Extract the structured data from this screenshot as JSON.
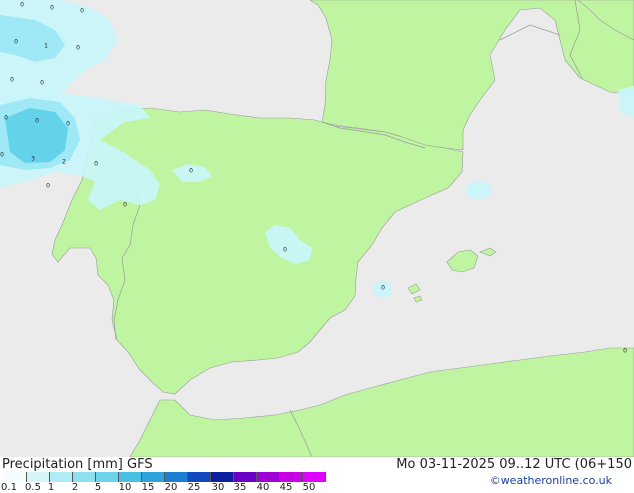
{
  "map": {
    "sea_color": "#ebebeb",
    "land_color": "#bff5a0",
    "border_color": "#9a9a9a",
    "precip_light": "#c8f5fa",
    "precip_mid": "#9fe8f5",
    "precip_dark": "#63d3ea",
    "contour_labels": [
      {
        "id": "c1",
        "text": "0"
      },
      {
        "id": "c2",
        "text": "0"
      },
      {
        "id": "c3",
        "text": "0"
      },
      {
        "id": "c4",
        "text": "1"
      },
      {
        "id": "c5",
        "text": "0"
      },
      {
        "id": "c6",
        "text": "0"
      },
      {
        "id": "c7",
        "text": "0"
      },
      {
        "id": "c8",
        "text": "0"
      },
      {
        "id": "c9",
        "text": "0"
      },
      {
        "id": "c10",
        "text": "0"
      },
      {
        "id": "c11",
        "text": "0"
      },
      {
        "id": "c12",
        "text": "0"
      },
      {
        "id": "c13",
        "text": "3"
      },
      {
        "id": "c14",
        "text": "2"
      },
      {
        "id": "c15",
        "text": "0"
      },
      {
        "id": "c16",
        "text": "0"
      },
      {
        "id": "c17",
        "text": "0"
      },
      {
        "id": "c18",
        "text": "0"
      },
      {
        "id": "c19",
        "text": "0"
      },
      {
        "id": "c20",
        "text": "0"
      },
      {
        "id": "c21",
        "text": "0"
      }
    ]
  },
  "footer": {
    "title": "Precipitation [mm] GFS",
    "datetime": "Mo 03-11-2025 09..12 UTC (06+150",
    "credit": "©weatheronline.co.uk"
  },
  "legend": {
    "labels": [
      "0.1",
      "0.5",
      "1",
      "2",
      "5",
      "10",
      "15",
      "20",
      "25",
      "30",
      "35",
      "40",
      "45",
      "50"
    ],
    "colors": [
      "#f5fcfd",
      "#d5f5f9",
      "#b0ecf5",
      "#8ee0f0",
      "#6dd3ea",
      "#47c0e3",
      "#2da2dc",
      "#1a7fd2",
      "#1349bf",
      "#0b1fa0",
      "#6a00c8",
      "#a000d8",
      "#c800e6",
      "#e000ff"
    ]
  }
}
